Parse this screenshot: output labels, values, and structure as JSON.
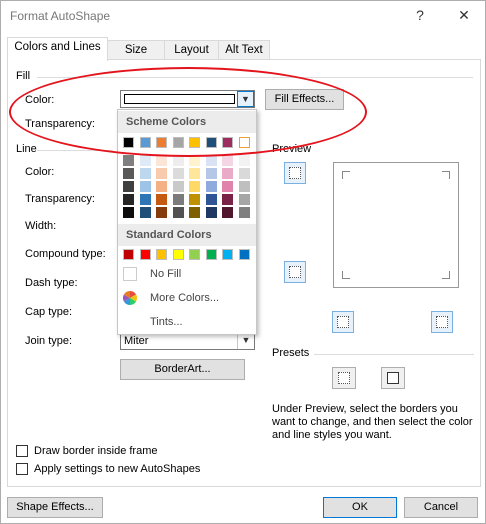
{
  "window": {
    "title": "Format AutoShape",
    "help_label": "?",
    "close_label": "✕"
  },
  "tabs": [
    {
      "label": "Colors and Lines"
    },
    {
      "label": "Size"
    },
    {
      "label": "Layout"
    },
    {
      "label": "Alt Text"
    }
  ],
  "fill": {
    "group_label": "Fill",
    "color_label": "Color:",
    "transparency_label": "Transparency:",
    "fill_effects_label": "Fill Effects..."
  },
  "line": {
    "group_label": "Line",
    "color_label": "Color:",
    "transparency_label": "Transparency:",
    "width_label": "Width:",
    "compound_label": "Compound type:",
    "dash_label": "Dash type:",
    "cap_label": "Cap type:",
    "join_label": "Join type:",
    "join_value": "Miter",
    "borderart_label": "BorderArt..."
  },
  "color_popup": {
    "scheme_header": "Scheme Colors",
    "standard_header": "Standard Colors",
    "scheme_top": [
      "#000000",
      "#5b9bd5",
      "#ed7d31",
      "#a5a5a5",
      "#ffc000",
      "#1f4e79",
      "#9e2d5f",
      "#ffffff"
    ],
    "scheme_shades": [
      [
        "#7f7f7f",
        "#deebf7",
        "#fbe5d6",
        "#ededed",
        "#fff2cc",
        "#dae3f3",
        "#f4d5e3",
        "#f2f2f2"
      ],
      [
        "#595959",
        "#bdd7ee",
        "#f8cbad",
        "#dbdbdb",
        "#ffe699",
        "#b4c7e7",
        "#e9abc7",
        "#d9d9d9"
      ],
      [
        "#404040",
        "#9dc3e6",
        "#f4b183",
        "#c9c9c9",
        "#ffd966",
        "#8faadc",
        "#df82ac",
        "#bfbfbf"
      ],
      [
        "#262626",
        "#2e75b6",
        "#c55a11",
        "#7b7b7b",
        "#bf9000",
        "#2f5597",
        "#7a2247",
        "#a6a6a6"
      ],
      [
        "#0d0d0d",
        "#1f4e79",
        "#843c0c",
        "#525252",
        "#7f6000",
        "#203864",
        "#51172f",
        "#808080"
      ]
    ],
    "standard": [
      "#c00000",
      "#ff0000",
      "#ffc000",
      "#ffff00",
      "#92d050",
      "#00b050",
      "#00b0f0",
      "#0070c0"
    ],
    "no_fill_label": "No Fill",
    "more_colors_label": "More Colors...",
    "tints_label": "Tints..."
  },
  "preview": {
    "label": "Preview"
  },
  "presets": {
    "label": "Presets",
    "instructions": "Under Preview, select the borders you want to change, and then select the color and line styles you want."
  },
  "checkboxes": {
    "draw_inside": "Draw border inside frame",
    "apply_new": "Apply settings to new AutoShapes"
  },
  "footer": {
    "shape_effects_label": "Shape Effects...",
    "ok_label": "OK",
    "cancel_label": "Cancel"
  }
}
